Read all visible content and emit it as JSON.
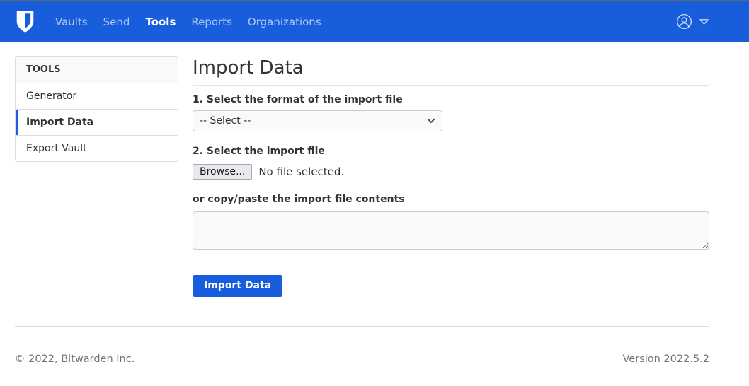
{
  "nav": {
    "items": [
      {
        "label": "Vaults"
      },
      {
        "label": "Send"
      },
      {
        "label": "Tools"
      },
      {
        "label": "Reports"
      },
      {
        "label": "Organizations"
      }
    ]
  },
  "sidebar": {
    "header": "TOOLS",
    "items": [
      {
        "label": "Generator"
      },
      {
        "label": "Import Data"
      },
      {
        "label": "Export Vault"
      }
    ]
  },
  "main": {
    "title": "Import Data",
    "step1_label": "1. Select the format of the import file",
    "format_select": {
      "selected_value": "-- Select --"
    },
    "step2_label": "2. Select the import file",
    "browse_button_label": "Browse...",
    "file_status": "No file selected.",
    "paste_label": "or copy/paste the import file contents",
    "textarea_value": "",
    "submit_button_label": "Import Data"
  },
  "footer": {
    "copyright": "© 2022, Bitwarden Inc.",
    "version": "Version 2022.5.2"
  },
  "colors": {
    "accent_blue": "#175DDC",
    "navbar_background": "#175DDC",
    "active_item_bar": "#175DDC",
    "muted_text": "#6c757d"
  }
}
